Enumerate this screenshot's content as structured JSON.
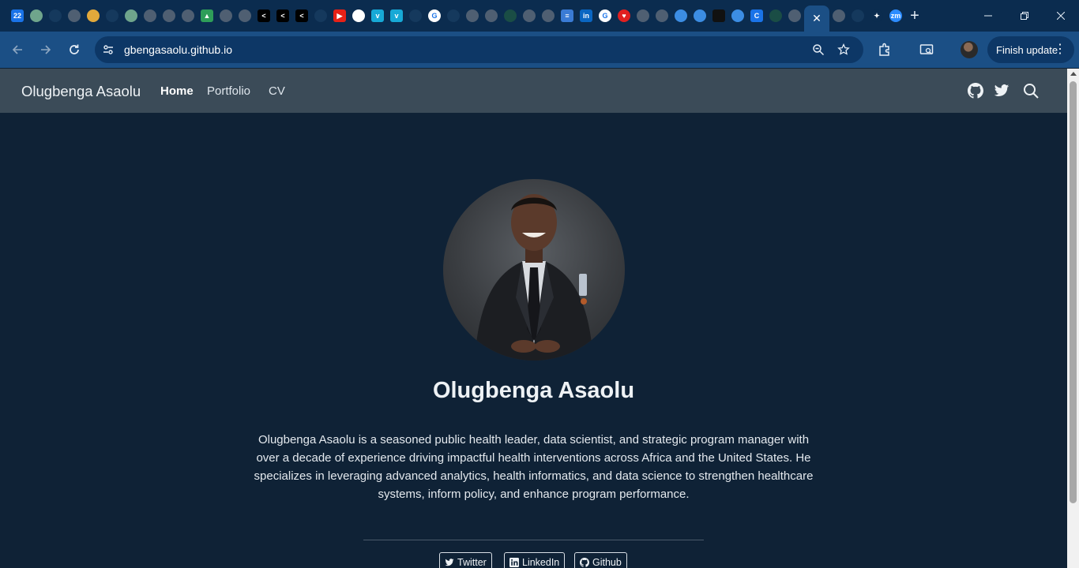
{
  "browser": {
    "tabs": [
      {
        "icon": "calendar-icon",
        "text": "22",
        "color": "#1a73e8",
        "shape": "sq"
      },
      {
        "icon": "circle-logo-icon",
        "text": "",
        "color": "#6fa58c"
      },
      {
        "icon": "heart-icon",
        "text": "",
        "color": "#15395d"
      },
      {
        "icon": "globe-icon",
        "text": "",
        "color": "#4f5f72"
      },
      {
        "icon": "coin-icon",
        "text": "",
        "color": "#e2a93b"
      },
      {
        "icon": "heart-icon",
        "text": "",
        "color": "#15395d"
      },
      {
        "icon": "circle-logo-icon",
        "text": "",
        "color": "#6fa58c"
      },
      {
        "icon": "globe-icon",
        "text": "",
        "color": "#4f5f72"
      },
      {
        "icon": "globe-icon",
        "text": "",
        "color": "#4f5f72"
      },
      {
        "icon": "globe-icon",
        "text": "",
        "color": "#4f5f72"
      },
      {
        "icon": "drive-icon",
        "text": "▲",
        "color": "#2e9e59",
        "shape": "sq"
      },
      {
        "icon": "globe-icon",
        "text": "",
        "color": "#4f5f72"
      },
      {
        "icon": "globe-icon",
        "text": "",
        "color": "#4f5f72"
      },
      {
        "icon": "share-icon",
        "text": "<",
        "color": "#000000",
        "shape": "sq"
      },
      {
        "icon": "share-icon",
        "text": "<",
        "color": "#000000",
        "shape": "sq"
      },
      {
        "icon": "share-icon",
        "text": "<",
        "color": "#000000",
        "shape": "sq"
      },
      {
        "icon": "heart-icon",
        "text": "",
        "color": "#15395d"
      },
      {
        "icon": "youtube-icon",
        "text": "▶",
        "color": "#e62117",
        "shape": "sq"
      },
      {
        "icon": "openai-icon",
        "text": "",
        "color": "#ffffff"
      },
      {
        "icon": "vimeo-icon",
        "text": "v",
        "color": "#17a9d6",
        "shape": "sq"
      },
      {
        "icon": "vimeo-icon",
        "text": "v",
        "color": "#17a9d6",
        "shape": "sq"
      },
      {
        "icon": "github-icon",
        "text": "",
        "color": "#15395d"
      },
      {
        "icon": "google-icon",
        "text": "G",
        "color": "#ffffff"
      },
      {
        "icon": "heart-icon",
        "text": "",
        "color": "#15395d"
      },
      {
        "icon": "globe-icon",
        "text": "",
        "color": "#4f5f72"
      },
      {
        "icon": "globe-icon",
        "text": "",
        "color": "#4f5f72"
      },
      {
        "icon": "leaf-icon",
        "text": "",
        "color": "#1a4d45"
      },
      {
        "icon": "globe-icon",
        "text": "",
        "color": "#4f5f72"
      },
      {
        "icon": "globe-icon",
        "text": "",
        "color": "#4f5f72"
      },
      {
        "icon": "document-icon",
        "text": "≡",
        "color": "#3a7bd5",
        "shape": "sq"
      },
      {
        "icon": "linkedin-icon",
        "text": "in",
        "color": "#0a66c2",
        "shape": "sq"
      },
      {
        "icon": "google-icon",
        "text": "G",
        "color": "#ffffff"
      },
      {
        "icon": "heart-icon",
        "text": "♥",
        "color": "#e02020"
      },
      {
        "icon": "globe-icon",
        "text": "",
        "color": "#4f5f72"
      },
      {
        "icon": "globe-icon",
        "text": "",
        "color": "#4f5f72"
      },
      {
        "icon": "web-icon",
        "text": "",
        "color": "#3c8de3"
      },
      {
        "icon": "web-icon",
        "text": "",
        "color": "#3c8de3"
      },
      {
        "icon": "stats-icon",
        "text": "",
        "color": "#111111",
        "shape": "sq"
      },
      {
        "icon": "web-icon",
        "text": "",
        "color": "#3c8de3"
      },
      {
        "icon": "c-icon",
        "text": "C",
        "color": "#1a73e8",
        "shape": "sq"
      },
      {
        "icon": "leaf-icon",
        "text": "",
        "color": "#1a4d45"
      },
      {
        "icon": "globe-icon",
        "text": "",
        "color": "#4f5f72"
      }
    ],
    "tabs_after_active": [
      {
        "icon": "globe-icon",
        "text": "",
        "color": "#4f5f72"
      },
      {
        "icon": "github-icon",
        "text": "",
        "color": "#15395d"
      },
      {
        "icon": "sparkle-icon",
        "text": "✦",
        "color": "#0b2c4f"
      },
      {
        "icon": "zoom-icon",
        "text": "zm",
        "color": "#2d8cff"
      }
    ],
    "active_tab_close": "✕",
    "new_tab": "+",
    "url": "gbengasaolu.github.io",
    "update_label": "Finish update",
    "colors": {
      "tabstrip": "#0b2c4f",
      "toolbar": "#1b4f85",
      "omnibox": "#0d3766"
    }
  },
  "site": {
    "brand": "Olugbenga Asaolu",
    "nav": {
      "home": "Home",
      "portfolio": "Portfolio",
      "cv": "CV"
    },
    "nav_icons": [
      "github-icon",
      "twitter-icon",
      "search-icon"
    ]
  },
  "hero": {
    "name": "Olugbenga Asaolu",
    "bio": "Olugbenga Asaolu is a seasoned public health leader, data scientist, and strategic program manager with over a decade of experience driving impactful health interventions across Africa and the United States. He specializes in leveraging advanced analytics, health informatics, and data science to strengthen healthcare systems, inform policy, and enhance program performance.",
    "social": {
      "twitter": "Twitter",
      "linkedin": "LinkedIn",
      "github": "Github"
    }
  },
  "colors": {
    "page_bg": "#0f2236",
    "nav_bg": "#3b4b58"
  }
}
